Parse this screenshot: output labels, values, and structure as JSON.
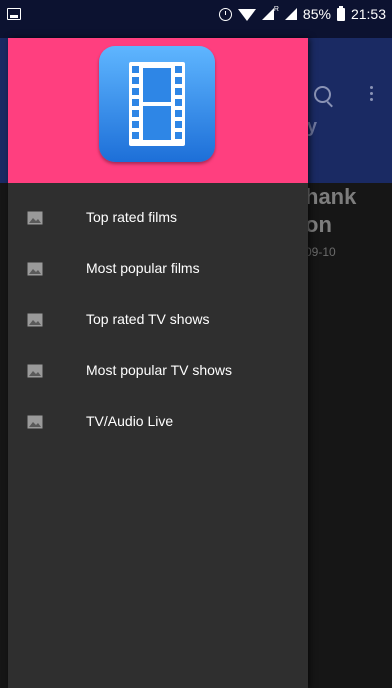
{
  "status_bar": {
    "battery_percent": "85%",
    "time": "21:53",
    "signal_badge": "R"
  },
  "background": {
    "title_partial": "hank\non",
    "date_partial": "09-10",
    "tab_partial": "y",
    "toolbar_color": "#1a2a63"
  },
  "drawer": {
    "header_color": "#ff3f7f",
    "logo_icon": "film-strip-icon",
    "items": [
      {
        "label": "Top rated films",
        "icon": "image-icon"
      },
      {
        "label": "Most popular films",
        "icon": "image-icon"
      },
      {
        "label": "Top rated TV shows",
        "icon": "image-icon"
      },
      {
        "label": "Most popular TV shows",
        "icon": "image-icon"
      },
      {
        "label": "TV/Audio Live",
        "icon": "image-icon"
      }
    ]
  }
}
